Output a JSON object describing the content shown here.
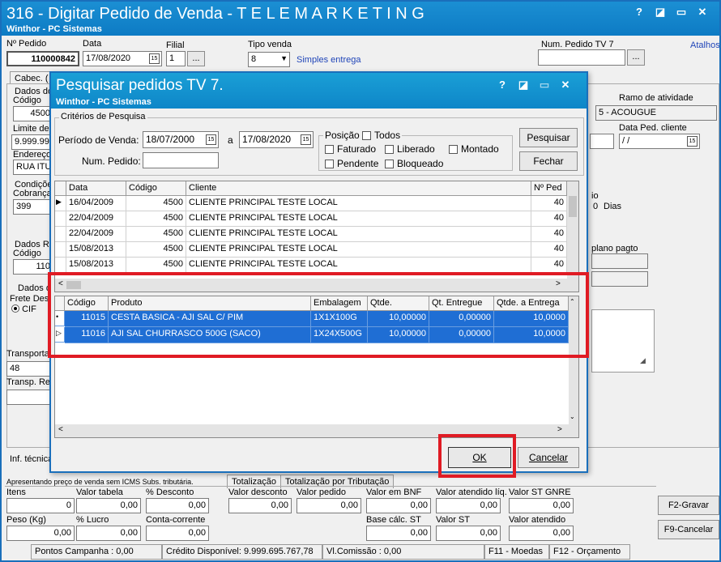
{
  "main": {
    "title": "316 - Digitar Pedido de Venda - T E L E M A R K E T I N G",
    "subtitle": "Winthor - PC Sistemas",
    "titlebar_buttons": [
      "?",
      "◪",
      "▭",
      "✕"
    ],
    "labels": {
      "num_pedido": "Nº Pedido",
      "data": "Data",
      "filial": "Filial",
      "tipo_venda": "Tipo venda",
      "num_pedido_tv7": "Num. Pedido TV 7",
      "atalhos": "Atalhos"
    },
    "values": {
      "num_pedido": "110000842",
      "data": "17/08/2020",
      "filial": "1",
      "tipo_venda": "8",
      "tipo_venda_desc": "Simples entrega"
    },
    "ellipsis": "...",
    "left_fragments": {
      "cabec_tab": "Cabec. (",
      "dados_do": "Dados do",
      "codigo": "Código",
      "codigo_val": "4500",
      "limite_de": "Limite de",
      "limite_val": "9.999.999",
      "endereco": "Endereço",
      "endereco_val": "RUA ITUM",
      "condicoes": "Condiçõe",
      "cobranca": "Cobrança",
      "cobranca_val": "399",
      "dados_rc": "Dados RC",
      "codigo2": "Código",
      "codigo2_val": "110",
      "dados_c": "Dados d",
      "frete": "Frete Des",
      "cif": "CIF",
      "transporta": "Transporta",
      "transporta_val": "48",
      "transp_re": "Transp. Re",
      "inf_tecnica": "Inf. técnica"
    },
    "right_fragments": {
      "ramo": "Ramo de atividade",
      "ramo_val": "5 - ACOUGUE",
      "data_ped_cliente": "Data Ped. cliente",
      "data_ped_val": " / /",
      "dias_fragment": "io",
      "dias_val": "0",
      "dias": "Dias",
      "plano_pagto": "plano pagto"
    },
    "bottom": {
      "note": "Apresentando preço de venda sem ICMS Subs. tributária.",
      "tab_totalizacao": "Totalização",
      "tab_trib": "Totalização por Tributação",
      "fields": [
        {
          "label": "Itens",
          "value": "0"
        },
        {
          "label": "Valor tabela",
          "value": "0,00"
        },
        {
          "label": "% Desconto",
          "value": "0,00"
        },
        {
          "label": "Valor desconto",
          "value": "0,00"
        },
        {
          "label": "Valor pedido",
          "value": "0,00"
        },
        {
          "label": "Valor em BNF",
          "value": "0,00"
        },
        {
          "label": "Valor atendido líq.",
          "value": "0,00"
        },
        {
          "label": "Valor ST GNRE",
          "value": "0,00"
        },
        {
          "label": "Peso (Kg)",
          "value": "0,00"
        },
        {
          "label": "% Lucro",
          "value": "0,00"
        },
        {
          "label": "Conta-corrente",
          "value": "0,00"
        },
        {
          "label": "Base cálc. ST",
          "value": "0,00"
        },
        {
          "label": "Valor ST",
          "value": "0,00"
        },
        {
          "label": "Valor atendido",
          "value": "0,00"
        }
      ],
      "btn_gravar": "F2-Gravar",
      "btn_cancelar": "F9-Cancelar"
    },
    "status": [
      "Pontos Campanha : 0,00",
      "Crédito Disponível: 9.999.695.767,78",
      "Vl.Comissão : 0,00",
      "F11 - Moedas",
      "F12 - Orçamento"
    ]
  },
  "dialog": {
    "title": "Pesquisar pedidos TV 7.",
    "subtitle": "Winthor - PC Sistemas",
    "titlebar_buttons": [
      "?",
      "◪",
      "▭",
      "✕"
    ],
    "criteria_label": "Critérios de Pesquisa",
    "periodo_label": "Período de Venda:",
    "periodo_de": "18/07/2000",
    "a_label": "a",
    "periodo_ate": "17/08/2020",
    "num_pedido_label": "Num. Pedido:",
    "posicao_label": "Posição",
    "checks": {
      "todos": "Todos",
      "faturado": "Faturado",
      "liberado": "Liberado",
      "montado": "Montado",
      "pendente": "Pendente",
      "bloqueado": "Bloqueado"
    },
    "btn_pesquisar": "Pesquisar",
    "btn_fechar": "Fechar",
    "orders_columns": [
      "Data",
      "Código",
      "Cliente",
      "Nº Ped"
    ],
    "orders": [
      {
        "data": "16/04/2009",
        "codigo": "4500",
        "cliente": "CLIENTE PRINCIPAL TESTE LOCAL",
        "num": "40"
      },
      {
        "data": "22/04/2009",
        "codigo": "4500",
        "cliente": "CLIENTE PRINCIPAL TESTE LOCAL",
        "num": "40"
      },
      {
        "data": "22/04/2009",
        "codigo": "4500",
        "cliente": "CLIENTE PRINCIPAL TESTE LOCAL",
        "num": "40"
      },
      {
        "data": "15/08/2013",
        "codigo": "4500",
        "cliente": "CLIENTE PRINCIPAL TESTE LOCAL",
        "num": "40"
      },
      {
        "data": "15/08/2013",
        "codigo": "4500",
        "cliente": "CLIENTE PRINCIPAL TESTE LOCAL",
        "num": "40"
      }
    ],
    "items_columns": [
      "Código",
      "Produto",
      "Embalagem",
      "Qtde.",
      "Qt. Entregue",
      "Qtde. a Entrega"
    ],
    "items": [
      {
        "codigo": "11015",
        "produto": "CESTA BASICA - AJI SAL C/ PIM",
        "embalagem": "1X1X100G",
        "qtde": "10,00000",
        "entregue": "0,00000",
        "a_entregar": "10,0000"
      },
      {
        "codigo": "11016",
        "produto": "AJI SAL CHURRASCO 500G (SACO)",
        "embalagem": "1X24X500G",
        "qtde": "10,00000",
        "entregue": "0,00000",
        "a_entregar": "10,0000"
      }
    ],
    "btn_ok": "OK",
    "btn_cancelar": "Cancelar",
    "colors": {
      "selection": "#1f6ed4",
      "highlight": "#e01b24",
      "title": "#0e86c8"
    }
  }
}
